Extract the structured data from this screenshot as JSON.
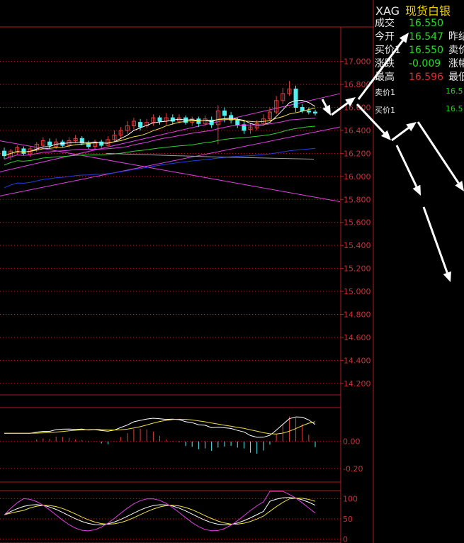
{
  "colors": {
    "background": "#000000",
    "border": "#b01c22",
    "axis_text": "#c8323a",
    "up_candle": "#e04040",
    "down_candle": "#50f0f0",
    "ma5": "#ffffff",
    "ma10": "#f0e040",
    "ma20": "#e040e0",
    "ma30": "#30d030",
    "ma60": "#2040e0",
    "gray_line": "#a0a0a0",
    "green_text": "#20e020",
    "red_text": "#e03030",
    "arrow": "#ffffff"
  },
  "quote": {
    "symbol": "XAG",
    "name": "现货白银",
    "rows": [
      {
        "label": "成交",
        "value": "16.550",
        "color": "#20e020",
        "label2": ""
      },
      {
        "label": "今开",
        "value": "16.547",
        "color": "#20e020",
        "label2": "昨结"
      },
      {
        "label": "买价1",
        "value": "16.550",
        "color": "#20e020",
        "label2": "卖价"
      },
      {
        "label": "涨跌",
        "value": "-0.009",
        "color": "#20e020",
        "label2": "涨幅"
      },
      {
        "label": "最高",
        "value": "16.596",
        "color": "#e03030",
        "label2": "最低"
      }
    ],
    "sell1_label": "卖价1",
    "sell1_value": "16.5",
    "buy1_label": "买价1",
    "buy1_value": "16.5"
  },
  "chart_data": [
    {
      "type": "candlestick",
      "title": "",
      "ylim": [
        14.1,
        17.3
      ],
      "y_ticks": [
        "17.000",
        "16.800",
        "16.600",
        "16.400",
        "16.200",
        "16.000",
        "15.800",
        "15.600",
        "15.400",
        "15.200",
        "15.000",
        "14.800",
        "14.600",
        "14.400",
        "14.200"
      ],
      "y_tick_values": [
        17.0,
        16.8,
        16.6,
        16.4,
        16.2,
        16.0,
        15.8,
        15.6,
        15.4,
        15.2,
        15.0,
        14.8,
        14.6,
        14.4,
        14.2
      ],
      "grid": true,
      "candles": [
        [
          16.22,
          16.18,
          16.25,
          16.15
        ],
        [
          16.17,
          16.22,
          16.24,
          16.14
        ],
        [
          16.21,
          16.25,
          16.27,
          16.19
        ],
        [
          16.24,
          16.2,
          16.26,
          16.18
        ],
        [
          16.19,
          16.24,
          16.26,
          16.17
        ],
        [
          16.23,
          16.28,
          16.3,
          16.21
        ],
        [
          16.27,
          16.31,
          16.34,
          16.25
        ],
        [
          16.3,
          16.27,
          16.33,
          16.24
        ],
        [
          16.26,
          16.3,
          16.33,
          16.24
        ],
        [
          16.3,
          16.27,
          16.32,
          16.25
        ],
        [
          16.27,
          16.31,
          16.34,
          16.25
        ],
        [
          16.31,
          16.33,
          16.36,
          16.29
        ],
        [
          16.33,
          16.29,
          16.35,
          16.27
        ],
        [
          16.29,
          16.26,
          16.31,
          16.24
        ],
        [
          16.26,
          16.3,
          16.32,
          16.24
        ],
        [
          16.3,
          16.27,
          16.32,
          16.25
        ],
        [
          16.27,
          16.32,
          16.35,
          16.25
        ],
        [
          16.32,
          16.36,
          16.4,
          16.3
        ],
        [
          16.36,
          16.4,
          16.43,
          16.33
        ],
        [
          16.4,
          16.44,
          16.48,
          16.37
        ],
        [
          16.44,
          16.48,
          16.51,
          16.41
        ],
        [
          16.47,
          16.43,
          16.5,
          16.4
        ],
        [
          16.44,
          16.47,
          16.5,
          16.42
        ],
        [
          16.47,
          16.51,
          16.54,
          16.44
        ],
        [
          16.51,
          16.48,
          16.53,
          16.45
        ],
        [
          16.48,
          16.51,
          16.55,
          16.45
        ],
        [
          16.51,
          16.48,
          16.54,
          16.45
        ],
        [
          16.48,
          16.51,
          16.54,
          16.46
        ],
        [
          16.51,
          16.47,
          16.53,
          16.45
        ],
        [
          16.47,
          16.5,
          16.52,
          16.44
        ],
        [
          16.5,
          16.46,
          16.52,
          16.43
        ],
        [
          16.46,
          16.5,
          16.53,
          16.44
        ],
        [
          16.49,
          16.45,
          16.52,
          16.42
        ],
        [
          16.45,
          16.57,
          16.62,
          16.28
        ],
        [
          16.57,
          16.53,
          16.6,
          16.47
        ],
        [
          16.53,
          16.49,
          16.56,
          16.46
        ],
        [
          16.49,
          16.45,
          16.51,
          16.42
        ],
        [
          16.45,
          16.4,
          16.48,
          16.37
        ],
        [
          16.41,
          16.43,
          16.46,
          16.37
        ],
        [
          16.42,
          16.46,
          16.49,
          16.4
        ],
        [
          16.46,
          16.5,
          16.54,
          16.44
        ],
        [
          16.5,
          16.56,
          16.6,
          16.48
        ],
        [
          16.56,
          16.66,
          16.7,
          16.54
        ],
        [
          16.66,
          16.72,
          16.77,
          16.63
        ],
        [
          16.72,
          16.76,
          16.83,
          16.7
        ],
        [
          16.76,
          16.6,
          16.79,
          16.56
        ],
        [
          16.6,
          16.57,
          16.63,
          16.55
        ],
        [
          16.57,
          16.56,
          16.6,
          16.54
        ],
        [
          16.56,
          16.55,
          16.58,
          16.53
        ]
      ]
    },
    {
      "type": "macd",
      "y_ticks": [
        "0.00",
        "-0.20"
      ],
      "y_tick_values": [
        0.0,
        -0.2
      ],
      "ylim": [
        -0.3,
        0.25
      ]
    },
    {
      "type": "kdj",
      "y_ticks": [
        "100",
        "50",
        "0"
      ],
      "y_tick_values": [
        100,
        50,
        0
      ],
      "ylim": [
        -10,
        120
      ]
    }
  ]
}
